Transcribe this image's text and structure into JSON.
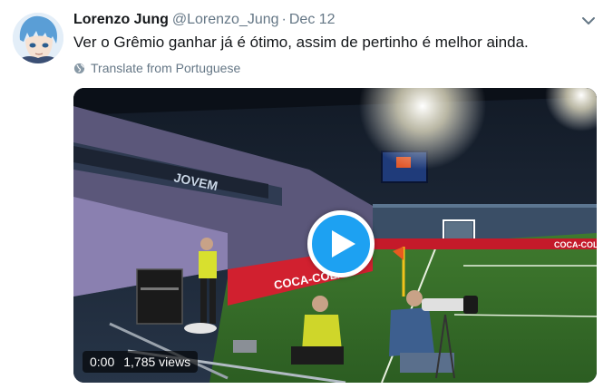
{
  "tweet": {
    "display_name": "Lorenzo Jung",
    "handle": "@Lorenzo_Jung",
    "separator": "·",
    "date": "Dec 12",
    "text": "Ver o Grêmio ganhar já é ótimo, assim de pertinho é melhor ainda.",
    "translate_label": "Translate from Portuguese",
    "avatar_icon": "anime-avatar-icon",
    "menu_icon": "chevron-down-icon",
    "translate_icon": "globe-icon"
  },
  "video": {
    "time": "0:00",
    "views": "1,785 views",
    "play_icon": "play-icon",
    "scene_text": {
      "banner_left": "COCA-COLA",
      "banner_right": "COCA-COLA",
      "crowd_banner": "JOVEM"
    }
  },
  "colors": {
    "accent": "#1da1f2",
    "text_primary": "#14171a",
    "text_secondary": "#657786",
    "pitch_green": "#3f7a2e",
    "ad_board_red": "#d1202f"
  }
}
